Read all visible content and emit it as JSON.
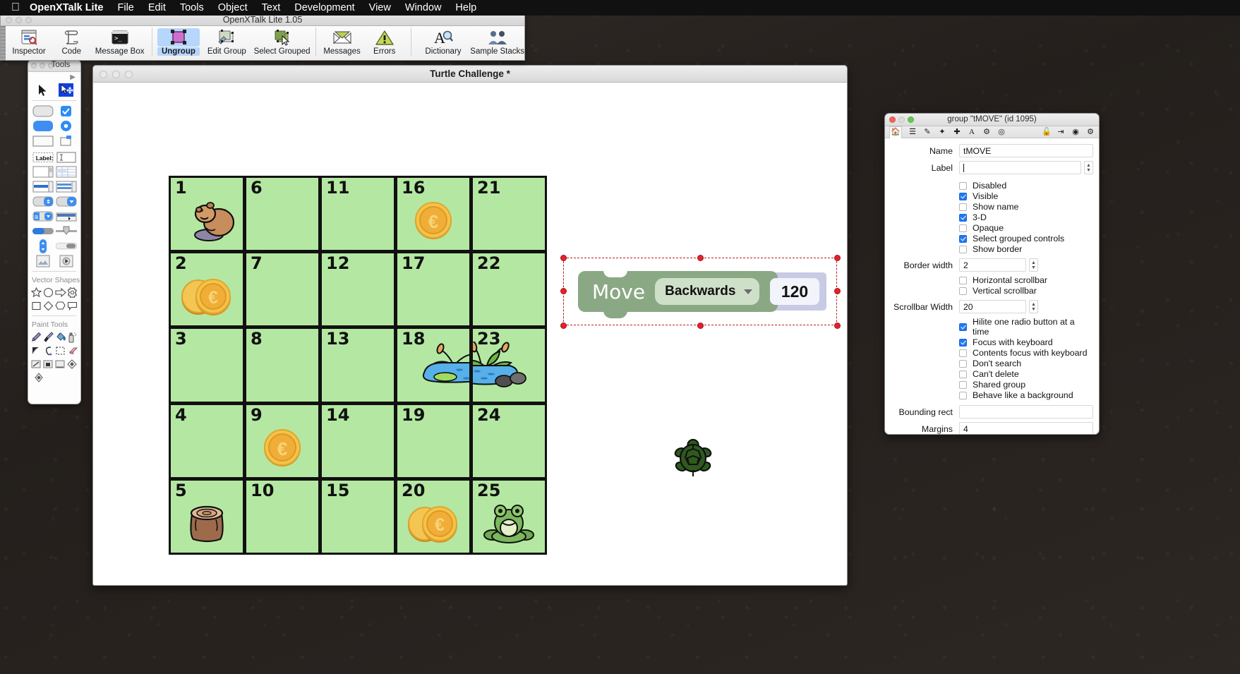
{
  "menubar": {
    "apple_icon": "apple-icon",
    "app_name": "OpenXTalk Lite",
    "items": [
      "File",
      "Edit",
      "Tools",
      "Object",
      "Text",
      "Development",
      "View",
      "Window",
      "Help"
    ]
  },
  "ide_window": {
    "title": "OpenXTalk Lite 1.05",
    "toolbar": [
      {
        "label": "Inspector",
        "icon": "inspector-icon",
        "selected": false
      },
      {
        "label": "Code",
        "icon": "code-scroll-icon",
        "selected": false
      },
      {
        "label": "Message Box",
        "icon": "message-box-icon",
        "selected": false
      },
      {
        "label": "Ungroup",
        "icon": "ungroup-icon",
        "selected": true
      },
      {
        "label": "Edit Group",
        "icon": "edit-group-icon",
        "selected": false
      },
      {
        "label": "Select Grouped",
        "icon": "select-grouped-icon",
        "selected": false
      },
      {
        "label": "Messages",
        "icon": "envelope-icon",
        "selected": false
      },
      {
        "label": "Errors",
        "icon": "warning-triangle-icon",
        "selected": false
      },
      {
        "label": "Dictionary",
        "icon": "dictionary-icon",
        "selected": false
      },
      {
        "label": "Sample Stacks",
        "icon": "sample-stacks-icon",
        "selected": false
      }
    ]
  },
  "tools_palette": {
    "title": "Tools",
    "sections": [
      {
        "name": "pointer-tools",
        "items": [
          "pointer-arrow-icon",
          "edit-move-icon"
        ]
      },
      {
        "name": "controls",
        "items": [
          "push-button-icon",
          "checkbox-icon",
          "default-button-icon",
          "radio-button-icon",
          "rectangle-button-icon",
          "popup-menu-icon",
          "label-field-icon",
          "text-field-icon",
          "scrolling-field-icon",
          "table-field-icon",
          "list-field-icon",
          "multi-column-list-icon",
          "combo-box-icon",
          "option-menu-icon",
          "combobox-text-icon",
          "tab-panel-icon",
          "progress-bar-icon",
          "slider-icon",
          "scrollbar-vertical-icon",
          "scrollbar-horizontal-icon",
          "image-area-icon",
          "player-icon"
        ]
      },
      {
        "name": "Vector Shapes",
        "items": [
          "star-shape-icon",
          "circle-shape-icon",
          "arrow-shape-icon",
          "gear-shape-icon",
          "square-shape-icon",
          "diamond-shape-icon",
          "polygon-shape-icon",
          "speech-balloon-icon"
        ]
      },
      {
        "name": "Paint Tools",
        "items": [
          "pencil-tool-icon",
          "brush-tool-icon",
          "bucket-fill-icon",
          "spray-can-icon",
          "polygon-fill-icon",
          "curve-tool-icon",
          "marquee-select-icon",
          "eraser-icon",
          "line-tool-icon",
          "rectangle-tool-icon",
          "oval-tool-icon",
          "irregular-polygon-icon",
          "color-picker-icon"
        ]
      }
    ],
    "vector_shapes_label": "Vector Shapes",
    "paint_tools_label": "Paint Tools",
    "label_sample_text": "Label:"
  },
  "card_window": {
    "title": "Turtle Challenge *"
  },
  "board": {
    "columns": 5,
    "rows": 5,
    "cells": [
      {
        "num": "1",
        "art": "beaver"
      },
      {
        "num": "6",
        "art": ""
      },
      {
        "num": "11",
        "art": ""
      },
      {
        "num": "16",
        "art": "coin"
      },
      {
        "num": "21",
        "art": ""
      },
      {
        "num": "2",
        "art": "coins"
      },
      {
        "num": "7",
        "art": ""
      },
      {
        "num": "12",
        "art": ""
      },
      {
        "num": "17",
        "art": ""
      },
      {
        "num": "22",
        "art": ""
      },
      {
        "num": "3",
        "art": ""
      },
      {
        "num": "8",
        "art": ""
      },
      {
        "num": "13",
        "art": ""
      },
      {
        "num": "18",
        "art": "pond-left"
      },
      {
        "num": "23",
        "art": "pond-right"
      },
      {
        "num": "4",
        "art": ""
      },
      {
        "num": "9",
        "art": "coin"
      },
      {
        "num": "14",
        "art": ""
      },
      {
        "num": "19",
        "art": ""
      },
      {
        "num": "24",
        "art": ""
      },
      {
        "num": "5",
        "art": "stump"
      },
      {
        "num": "10",
        "art": ""
      },
      {
        "num": "15",
        "art": ""
      },
      {
        "num": "20",
        "art": "coins"
      },
      {
        "num": "25",
        "art": "frog"
      }
    ],
    "cell_color": "#b4e8a2",
    "border_color": "#111111"
  },
  "move_block": {
    "command_label": "Move",
    "direction_value": "Backwards",
    "amount_value": "120",
    "block_color": "#8aa884",
    "dropdown_color": "#cfe0c9",
    "socket_color": "#c9cbe4",
    "selected": true,
    "handle_color": "#e8202a"
  },
  "turtle": {
    "icon": "turtle-icon",
    "color": "#2f5a1e"
  },
  "inspector": {
    "title": "group \"tMOVE\" (id 1095)",
    "toolbar_icons": [
      "home-icon",
      "stack-icon",
      "pencil-icon",
      "wand-icon",
      "move-icon",
      "text-A-icon",
      "effects-icon",
      "size-position-icon",
      "unlock-icon",
      "export-icon",
      "target-icon",
      "gear-icon"
    ],
    "fields": [
      {
        "label": "Name",
        "value": "tMOVE",
        "type": "text"
      },
      {
        "label": "Label",
        "value": "",
        "type": "text-caret-stepper"
      }
    ],
    "checks_group_1": [
      {
        "label": "Disabled",
        "checked": false
      },
      {
        "label": "Visible",
        "checked": true
      },
      {
        "label": "Show name",
        "checked": false
      },
      {
        "label": "3-D",
        "checked": true
      },
      {
        "label": "Opaque",
        "checked": false
      },
      {
        "label": "Select grouped controls",
        "checked": true
      },
      {
        "label": "Show border",
        "checked": false
      }
    ],
    "border_width": {
      "label": "Border width",
      "value": "2"
    },
    "checks_group_2": [
      {
        "label": "Horizontal scrollbar",
        "checked": false
      },
      {
        "label": "Vertical scrollbar",
        "checked": false
      }
    ],
    "scrollbar_width": {
      "label": "Scrollbar Width",
      "value": "20"
    },
    "checks_group_3": [
      {
        "label": "Hilite one radio button at a time",
        "checked": true
      },
      {
        "label": "Focus with keyboard",
        "checked": true
      },
      {
        "label": "Contents focus with keyboard",
        "checked": false
      },
      {
        "label": "Don't search",
        "checked": false
      },
      {
        "label": "Can't delete",
        "checked": false
      },
      {
        "label": "Shared group",
        "checked": false
      },
      {
        "label": "Behave like a background",
        "checked": false
      }
    ],
    "bounding_rect": {
      "label": "Bounding rect",
      "value": ""
    },
    "margins": {
      "label": "Margins",
      "value": "4"
    }
  }
}
